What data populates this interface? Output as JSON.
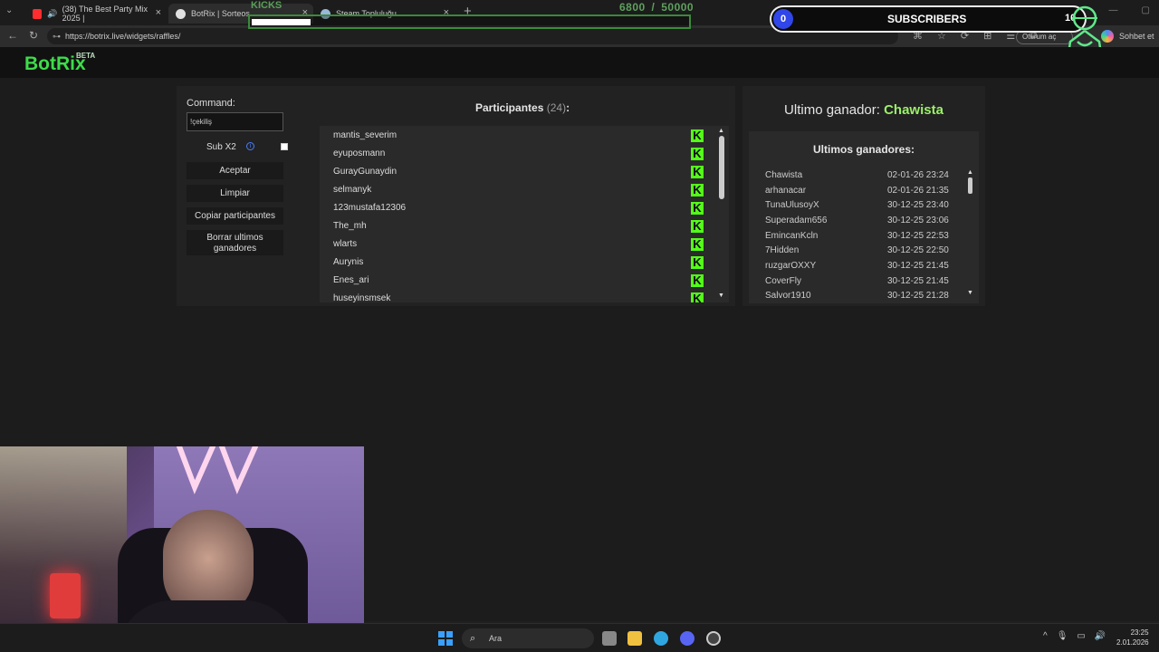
{
  "browser": {
    "tabs": [
      {
        "label": "(38) The Best Party Mix 2025 |",
        "favicon_color": "#ff2d2d"
      },
      {
        "label": "BotRix | Sorteos",
        "favicon_color": "#e0e0e0"
      },
      {
        "label": "Steam Topluluğu",
        "favicon_color": "#9ab8d8"
      }
    ],
    "url": "https://botrix.live/widgets/raffles/",
    "signin_label": "Oturum aç",
    "copilot_label": "Sohbet et"
  },
  "overlay": {
    "kicks_label": "KICKS",
    "kicks_current": "6800",
    "kicks_separator": "/",
    "kicks_goal": "50000",
    "kicks_progress": 0.136,
    "subs_count": "0",
    "subs_label": "SUBSCRIBERS",
    "subs_goal": "10"
  },
  "app": {
    "logo": "BotRix",
    "beta": "BETA",
    "command_label": "Command:",
    "command_value": "!çekiliş",
    "sub_x2_label": "Sub X2",
    "sub_x2_checked": false,
    "buttons": {
      "aceptar": "Aceptar",
      "limpiar": "Limpiar",
      "copiar": "Copiar participantes",
      "borrar": "Borrar ultimos ganadores"
    },
    "participants_title": "Participantes",
    "participants_count": "(24)",
    "participants_colon": ":",
    "participants": [
      "mantis_severim",
      "eyuposmann",
      "GurayGunaydin",
      "selmanyk",
      "123mustafa12306",
      "The_mh",
      "wlarts",
      "Aurynis",
      "Enes_ari",
      "huseyinsmsek"
    ],
    "kick_badge_letter": "K",
    "last_winner_prefix": "Ultimo ganador:",
    "last_winner_name": "Chawista",
    "winners_title": "Ultimos ganadores:",
    "winners": [
      {
        "name": "Chawista",
        "date": "02-01-26 23:24"
      },
      {
        "name": "arhanacar",
        "date": "02-01-26 21:35"
      },
      {
        "name": "TunaUlusoyX",
        "date": "30-12-25 23:40"
      },
      {
        "name": "Superadam656",
        "date": "30-12-25 23:06"
      },
      {
        "name": "EmincanKcln",
        "date": "30-12-25 22:53"
      },
      {
        "name": "7Hidden",
        "date": "30-12-25 22:50"
      },
      {
        "name": "ruzgarOXXY",
        "date": "30-12-25 21:45"
      },
      {
        "name": "CoverFly",
        "date": "30-12-25 21:45"
      },
      {
        "name": "Salvor1910",
        "date": "30-12-25 21:28"
      }
    ]
  },
  "taskbar": {
    "search_label": "Ara",
    "time": "23:25",
    "date": "2.01.2026"
  },
  "colors": {
    "accent_green": "#3ddc4a",
    "kick_green": "#53fc18",
    "winner_green": "#9cf06a",
    "subs_blue": "#3046e8"
  }
}
